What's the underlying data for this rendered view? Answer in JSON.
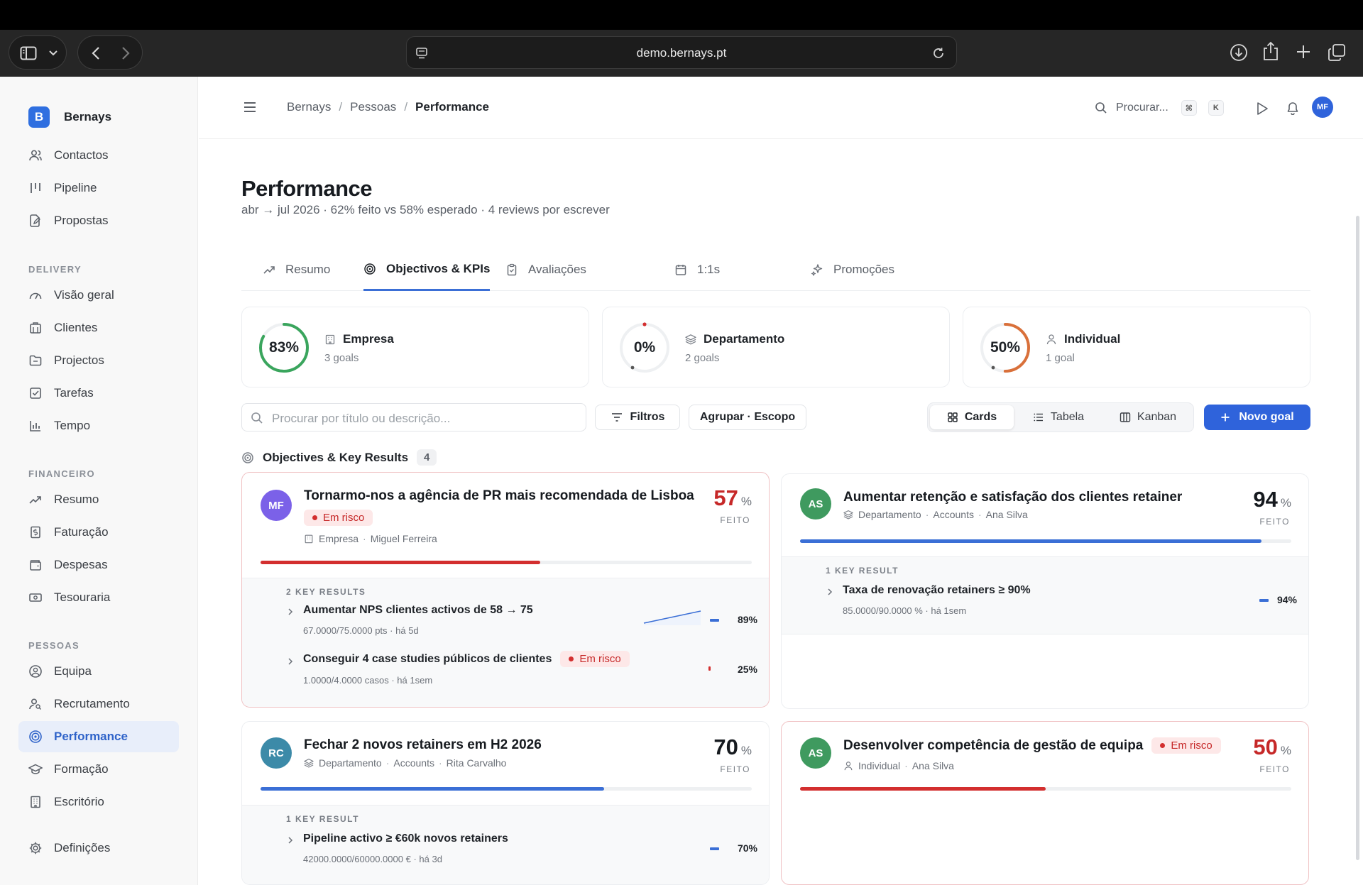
{
  "browser": {
    "url": "demo.bernays.pt"
  },
  "brand": {
    "logo_letter": "B",
    "name": "Bernays"
  },
  "nav": {
    "contactos": "Contactos",
    "pipeline": "Pipeline",
    "propostas": "Propostas",
    "delivery": "DELIVERY",
    "visao_geral": "Visão geral",
    "clientes": "Clientes",
    "projectos": "Projectos",
    "tarefas": "Tarefas",
    "tempo": "Tempo",
    "financeiro": "FINANCEIRO",
    "resumo": "Resumo",
    "faturacao": "Faturação",
    "despesas": "Despesas",
    "tesouraria": "Tesouraria",
    "pessoas": "PESSOAS",
    "equipa": "Equipa",
    "recrutamento": "Recrutamento",
    "performance": "Performance",
    "formacao": "Formação",
    "escritorio": "Escritório",
    "definicoes": "Definições"
  },
  "header": {
    "crumbs": [
      "Bernays",
      "Pessoas",
      "Performance"
    ],
    "search_label": "Procurar...",
    "kbd_cmd": "⌘",
    "kbd_k": "K",
    "avatar": "MF"
  },
  "page": {
    "title": "Performance",
    "subtitle": "abr → jul 2026 · 62% feito vs 58% esperado · 4 reviews por escrever"
  },
  "tabs": [
    {
      "label": "Resumo",
      "icon": "trend-icon"
    },
    {
      "label": "Objectivos & KPIs",
      "icon": "target-icon"
    },
    {
      "label": "Avaliações",
      "icon": "clipboard-icon"
    },
    {
      "label": "1:1s",
      "icon": "calendar-icon"
    },
    {
      "label": "Promoções",
      "icon": "sparkle-icon"
    }
  ],
  "scopes": [
    {
      "pct_label": "83%",
      "value": 0.83,
      "name": "Empresa",
      "count": "3 goals",
      "color": "#3aa55d",
      "icon": "building-icon"
    },
    {
      "pct_label": "0%",
      "value": 0,
      "name": "Departamento",
      "count": "2 goals",
      "color": "#d32f2f",
      "icon": "layers-icon"
    },
    {
      "pct_label": "50%",
      "value": 0.5,
      "name": "Individual",
      "count": "1 goal",
      "color": "#d9703a",
      "icon": "person-icon"
    }
  ],
  "toolbar": {
    "search_placeholder": "Procurar por título ou descrição...",
    "filters": "Filtros",
    "group": "Agrupar · Escopo",
    "views": [
      "Cards",
      "Tabela",
      "Kanban"
    ],
    "new_goal": "Novo goal"
  },
  "list": {
    "title": "Objectives & Key Results",
    "count": "4"
  },
  "goals": [
    {
      "avatar": "MF",
      "avatar_color": "#7b61e8",
      "title": "Tornarmo-nos a agência de PR mais recomendada de Lisboa",
      "badge": "Em risco",
      "scope": "Empresa",
      "dept": "",
      "owner": "Miguel Ferreira",
      "pct": "57",
      "pct_unit": "%",
      "feito": "FEITO",
      "progress": 0.57,
      "color": "#d32f2f",
      "kr_label": "2 KEY RESULTS",
      "krs": [
        {
          "title": "Aumentar NPS clientes activos de 58 → 75",
          "sub": "67.0000/75.0000 pts",
          "when": "há 5d",
          "pct": "89%",
          "badge": ""
        },
        {
          "title": "Conseguir 4 case studies públicos de clientes",
          "sub": "1.0000/4.0000 casos",
          "when": "há 1sem",
          "pct": "25%",
          "badge": "Em risco"
        }
      ]
    },
    {
      "avatar": "AS",
      "avatar_color": "#3f9a5f",
      "title": "Aumentar retenção e satisfação dos clientes retainer",
      "badge": "",
      "scope": "Departamento",
      "dept": "Accounts",
      "owner": "Ana Silva",
      "pct": "94",
      "pct_unit": "%",
      "feito": "FEITO",
      "progress": 0.94,
      "color": "#3b6fd6",
      "kr_label": "1 KEY RESULT",
      "krs": [
        {
          "title": "Taxa de renovação retainers ≥ 90%",
          "sub": "85.0000/90.0000 %",
          "when": "há 1sem",
          "pct": "94%",
          "badge": ""
        }
      ]
    },
    {
      "avatar": "RC",
      "avatar_color": "#3c8aa8",
      "title": "Fechar 2 novos retainers em H2 2026",
      "badge": "",
      "scope": "Departamento",
      "dept": "Accounts",
      "owner": "Rita Carvalho",
      "pct": "70",
      "pct_unit": "%",
      "feito": "FEITO",
      "progress": 0.7,
      "color": "#3b6fd6",
      "kr_label": "1 KEY RESULT",
      "krs": [
        {
          "title": "Pipeline activo ≥ €60k novos retainers",
          "sub": "42000.0000/60000.0000 €",
          "when": "há 3d",
          "pct": "70%",
          "badge": ""
        }
      ]
    },
    {
      "avatar": "AS",
      "avatar_color": "#3f9a5f",
      "title": "Desenvolver competência de gestão de equipa",
      "badge": "Em risco",
      "scope": "Individual",
      "dept": "",
      "owner": "Ana Silva",
      "pct": "50",
      "pct_unit": "%",
      "feito": "FEITO",
      "progress": 0.5,
      "color": "#d32f2f",
      "kr_label": "",
      "krs": []
    }
  ]
}
